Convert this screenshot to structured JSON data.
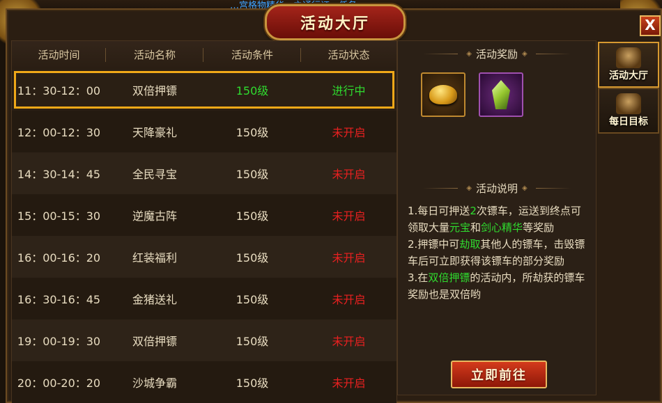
{
  "top_banner": "…宫格物精华…之通行证…任务…",
  "dialog": {
    "title": "活动大厅",
    "close_label": "X"
  },
  "table": {
    "headers": [
      "活动时间",
      "活动名称",
      "活动条件",
      "活动状态"
    ],
    "rows": [
      {
        "time": "11：30-12：00",
        "name": "双倍押镖",
        "level": "150级",
        "status": "进行中",
        "active": true
      },
      {
        "time": "12：00-12：30",
        "name": "天降豪礼",
        "level": "150级",
        "status": "未开启",
        "active": false
      },
      {
        "time": "14：30-14：45",
        "name": "全民寻宝",
        "level": "150级",
        "status": "未开启",
        "active": false
      },
      {
        "time": "15：00-15：30",
        "name": "逆魔古阵",
        "level": "150级",
        "status": "未开启",
        "active": false
      },
      {
        "time": "16：00-16：20",
        "name": "红装福利",
        "level": "150级",
        "status": "未开启",
        "active": false
      },
      {
        "time": "16：30-16：45",
        "name": "金猪送礼",
        "level": "150级",
        "status": "未开启",
        "active": false
      },
      {
        "time": "19：00-19：30",
        "name": "双倍押镖",
        "level": "150级",
        "status": "未开启",
        "active": false
      },
      {
        "time": "20：00-20：20",
        "name": "沙城争霸",
        "level": "150级",
        "status": "未开启",
        "active": false
      }
    ]
  },
  "reward_section": {
    "title": "活动奖励",
    "items": [
      {
        "icon": "gold-ingot-icon"
      },
      {
        "icon": "green-crystal-icon"
      }
    ]
  },
  "desc_section": {
    "title": "活动说明",
    "p1a": "1.每日可押送",
    "p1b": "2",
    "p1c": "次镖车，运送到终点可领取大量",
    "p1d": "元宝",
    "p1e": "和",
    "p1f": "剑心精华",
    "p1g": "等奖励",
    "p2a": "2.押镖中可",
    "p2b": "劫取",
    "p2c": "其他人的镖车，击毁镖车后可立即获得该镖车的部分奖励",
    "p3a": "3.在",
    "p3b": "双倍押镖",
    "p3c": "的活动内，所劫获的镖车奖励也是双倍哟"
  },
  "go_button": "立即前往",
  "side_tabs": [
    {
      "label": "活动大厅",
      "icon": "armor-icon"
    },
    {
      "label": "每日目标",
      "icon": "treasure-chest-icon"
    }
  ],
  "colors": {
    "status_on": "#2fdc2f",
    "status_off": "#e82020",
    "highlight_border": "#f0a818"
  }
}
